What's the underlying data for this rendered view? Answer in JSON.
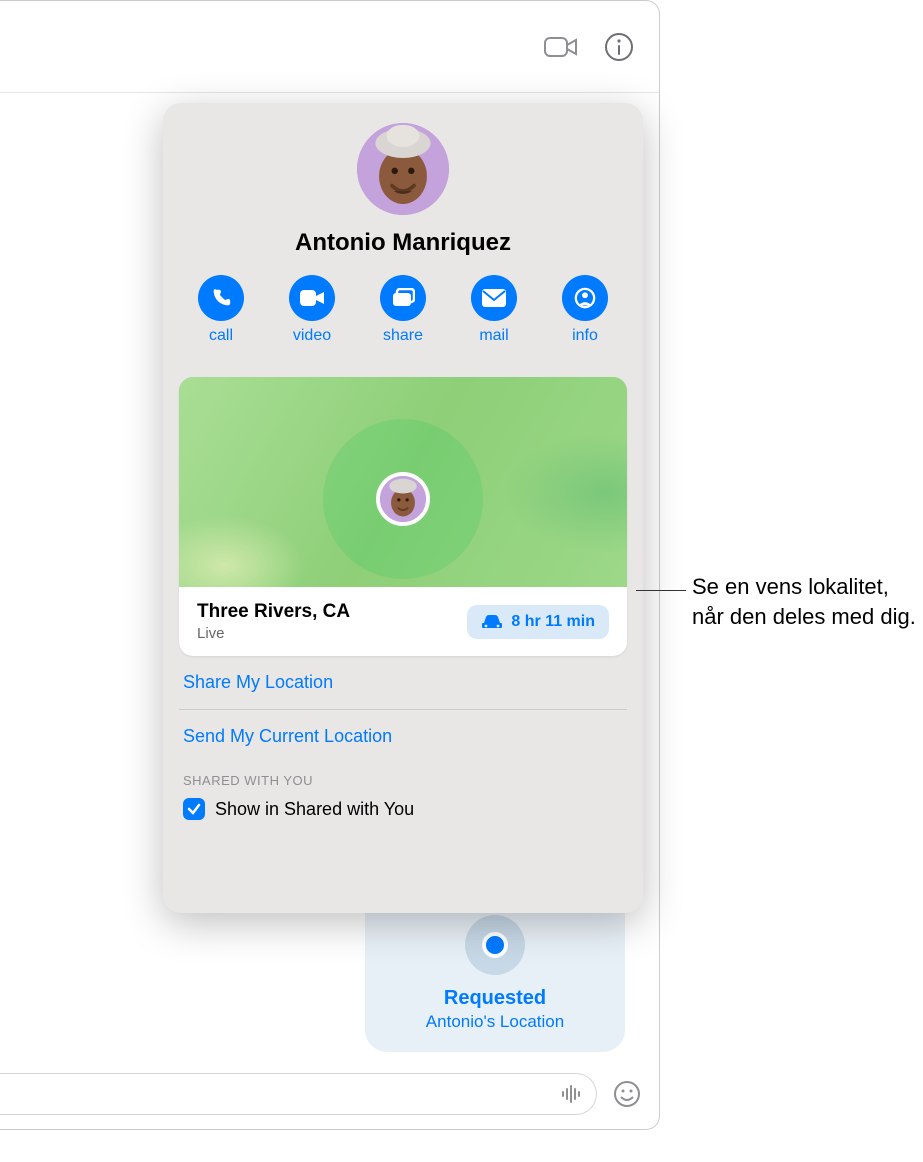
{
  "contact": {
    "name": "Antonio Manriquez"
  },
  "actions": {
    "call": "call",
    "video": "video",
    "share": "share",
    "mail": "mail",
    "info": "info"
  },
  "map": {
    "location": "Three Rivers, CA",
    "status": "Live",
    "eta": "8 hr 11 min"
  },
  "links": {
    "share_location": "Share My Location",
    "send_current": "Send My Current Location"
  },
  "shared": {
    "section_title": "SHARED WITH YOU",
    "show_label": "Show in Shared with You"
  },
  "bubble": {
    "title": "Requested",
    "subtitle": "Antonio's Location"
  },
  "callout": {
    "text": "Se en vens lokalitet, når den deles med dig."
  },
  "colors": {
    "accent": "#007aff"
  }
}
